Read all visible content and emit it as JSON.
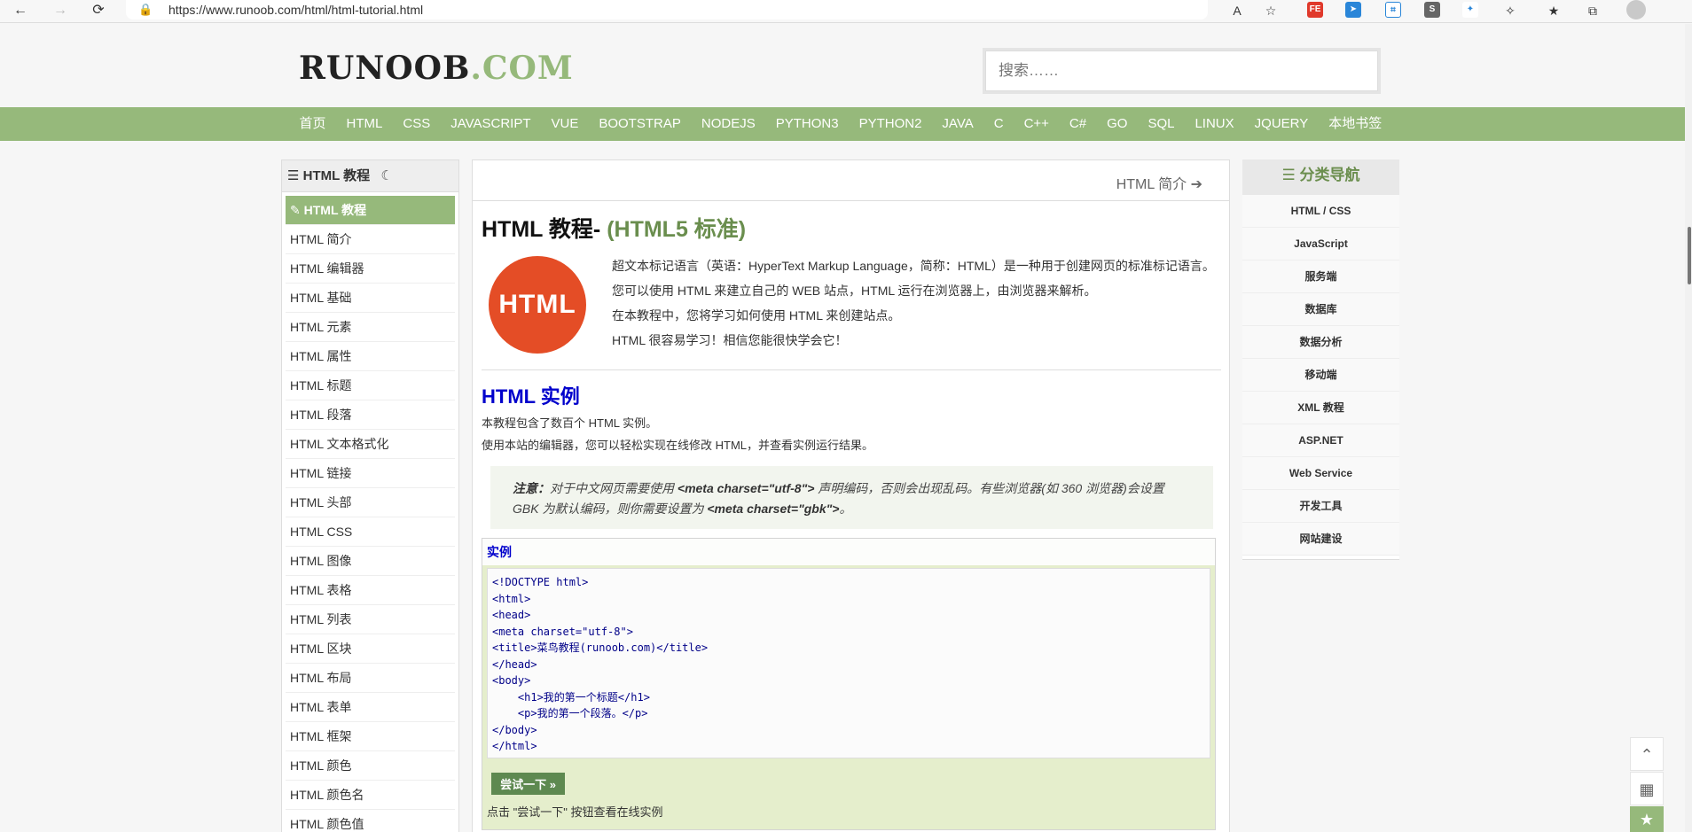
{
  "browser": {
    "url": "https://www.runoob.com/html/html-tutorial.html"
  },
  "header": {
    "logo_part1": "RUNOOB",
    "logo_part2": ".COM",
    "search_placeholder": "搜索……"
  },
  "topnav": [
    "首页",
    "HTML",
    "CSS",
    "JAVASCRIPT",
    "VUE",
    "BOOTSTRAP",
    "NODEJS",
    "PYTHON3",
    "PYTHON2",
    "JAVA",
    "C",
    "C++",
    "C#",
    "GO",
    "SQL",
    "LINUX",
    "JQUERY",
    "本地书签"
  ],
  "left_sidebar": {
    "title": "HTML 教程",
    "items": [
      "HTML 教程",
      "HTML 简介",
      "HTML 编辑器",
      "HTML 基础",
      "HTML 元素",
      "HTML 属性",
      "HTML 标题",
      "HTML 段落",
      "HTML 文本格式化",
      "HTML 链接",
      "HTML 头部",
      "HTML CSS",
      "HTML 图像",
      "HTML 表格",
      "HTML 列表",
      "HTML 区块",
      "HTML 布局",
      "HTML 表单",
      "HTML 框架",
      "HTML 颜色",
      "HTML 颜色名",
      "HTML 颜色值"
    ],
    "active_index": 0
  },
  "main": {
    "next_label": "HTML 简介",
    "title": "HTML 教程-",
    "title_sub": "(HTML5 标准)",
    "logo_text": "HTML",
    "intro": [
      "超文本标记语言（英语：HyperText Markup Language，简称：HTML）是一种用于创建网页的标准标记语言。",
      "您可以使用 HTML 来建立自己的 WEB 站点，HTML 运行在浏览器上，由浏览器来解析。",
      "在本教程中，您将学习如何使用 HTML 来创建站点。",
      "HTML 很容易学习！相信您能很快学会它！"
    ],
    "example_heading": "HTML 实例",
    "example_desc": [
      "本教程包含了数百个 HTML 实例。",
      "使用本站的编辑器，您可以轻松实现在线修改 HTML，并查看实例运行结果。"
    ],
    "note": {
      "label": "注意：",
      "text1": "对于中文网页需要使用",
      "code1": "<meta charset=\"utf-8\">",
      "text2": "声明编码，否则会出现乱码。有些浏览器(如 360 浏览器)会设置 GBK 为默认编码，则你需要设置为",
      "code2": "<meta charset=\"gbk\">",
      "text3": "。"
    },
    "example_box": {
      "label": "实例",
      "code_lines": [
        "<!DOCTYPE html>",
        "<html>",
        "<head>",
        "<meta charset=\"utf-8\">",
        "<title>菜鸟教程(runoob.com)</title>",
        "</head>",
        "<body>",
        "    <h1>我的第一个标题</h1>",
        "    <p>我的第一个段落。</p>",
        "</body>",
        "</html>"
      ],
      "try_button": "尝试一下 »",
      "try_note": "点击 \"尝试一下\" 按钮查看在线实例"
    }
  },
  "right_sidebar": {
    "title": "分类导航",
    "items": [
      "HTML / CSS",
      "JavaScript",
      "服务端",
      "数据库",
      "数据分析",
      "移动端",
      "XML 教程",
      "ASP.NET",
      "Web Service",
      "开发工具",
      "网站建设"
    ]
  },
  "colors": {
    "brand_green": "#96b97b",
    "link_blue": "#0000cc",
    "html_logo": "#e44d26"
  }
}
